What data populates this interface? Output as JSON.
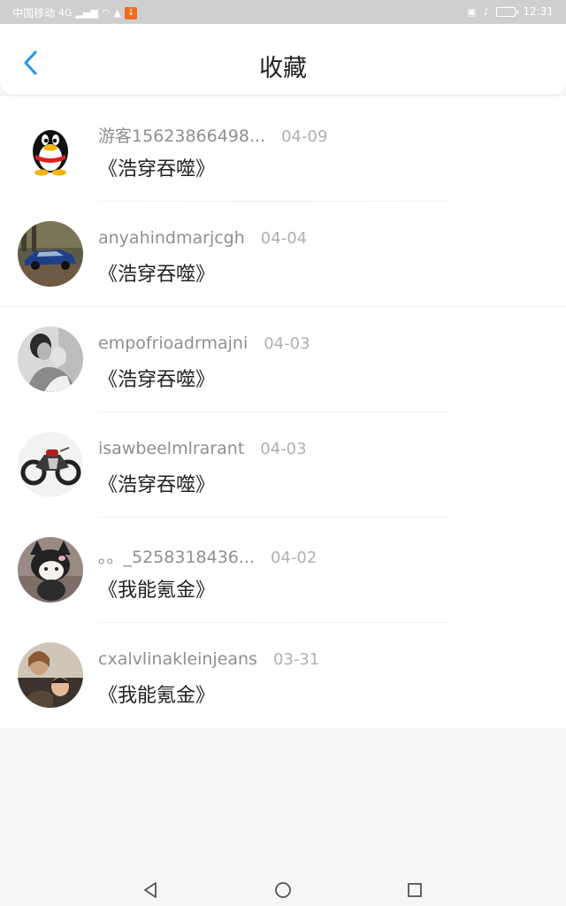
{
  "status_bar": {
    "carrier": "中国移动",
    "network": "4G",
    "time": "12:31"
  },
  "header": {
    "title": "收藏",
    "back_icon": "chevron-left-icon",
    "accent_color": "#1e9be8"
  },
  "favorites": [
    {
      "username": "游客15623866498...",
      "date": "04-09",
      "title": "《浩穿吞噬》",
      "avatar": "penguin-avatar"
    },
    {
      "username": "anyahindmarjcgh",
      "date": "04-04",
      "title": "《浩穿吞噬》",
      "avatar": "rally-car-avatar"
    },
    {
      "username": "empofrioadrmajni",
      "date": "04-03",
      "title": "《浩穿吞噬》",
      "avatar": "couple-photo-avatar"
    },
    {
      "username": "isawbeelmlrarant",
      "date": "04-03",
      "title": "《浩穿吞噬》",
      "avatar": "motorcycle-avatar"
    },
    {
      "username": "。。_5258318436...",
      "date": "04-02",
      "title": "《我能氪金》",
      "avatar": "plush-toy-avatar"
    },
    {
      "username": "cxalvlinakleinjeans",
      "date": "03-31",
      "title": "《我能氪金》",
      "avatar": "friends-photo-avatar"
    }
  ],
  "nav_bar": {
    "back": "triangle-back-icon",
    "home": "circle-home-icon",
    "recents": "square-recents-icon"
  }
}
